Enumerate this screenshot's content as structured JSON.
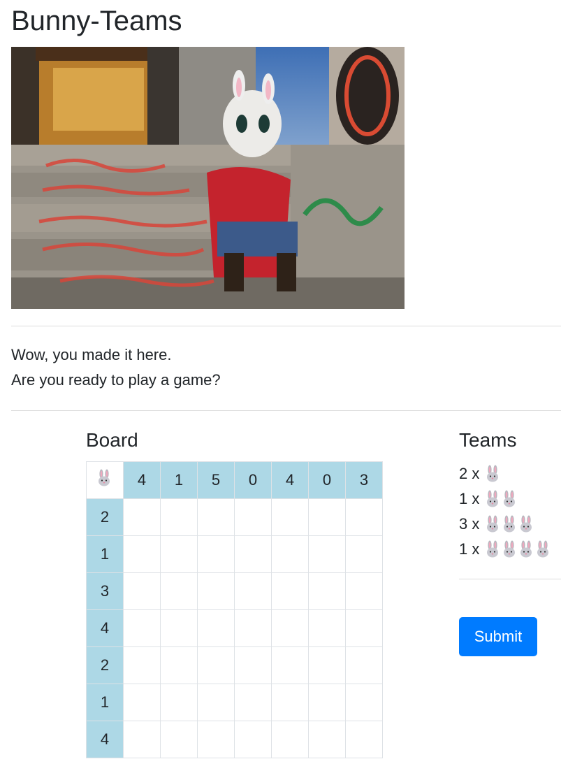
{
  "page": {
    "title": "Bunny-Teams"
  },
  "intro": {
    "line1": "Wow, you made it here.",
    "line2": "Are you ready to play a game?"
  },
  "board": {
    "title": "Board",
    "corner_icon": "bunny-icon",
    "column_hints": [
      "4",
      "1",
      "5",
      "0",
      "4",
      "0",
      "3"
    ],
    "row_hints": [
      "2",
      "1",
      "3",
      "4",
      "2",
      "1",
      "4"
    ]
  },
  "teams": {
    "title": "Teams",
    "items": [
      {
        "label": "2 x",
        "size": 1
      },
      {
        "label": "1 x",
        "size": 2
      },
      {
        "label": "3 x",
        "size": 3
      },
      {
        "label": "1 x",
        "size": 4
      }
    ]
  },
  "submit_label": "Submit",
  "colors": {
    "hint_bg": "#add8e6",
    "button": "#007bff",
    "grid_line": "#dee2e6"
  }
}
